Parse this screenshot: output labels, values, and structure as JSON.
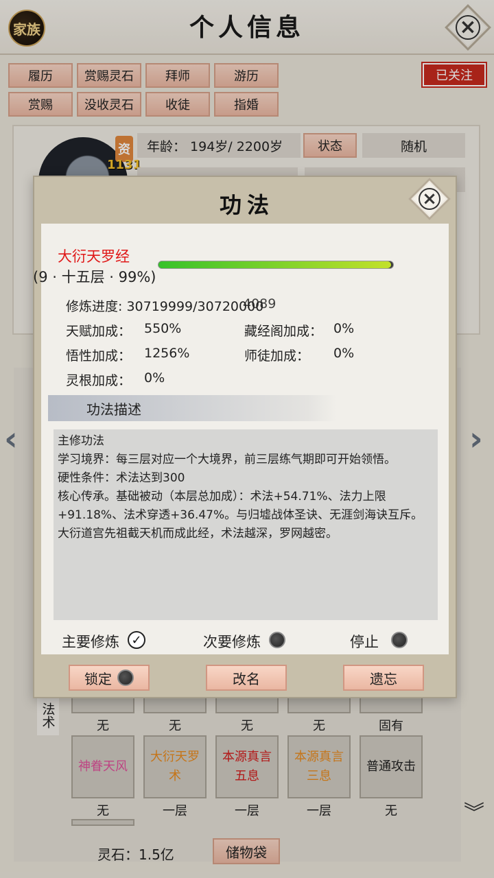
{
  "header": {
    "family_label": "家族",
    "title": "个人信息"
  },
  "actions_row1": [
    "履历",
    "赏赐灵石",
    "拜师",
    "游历"
  ],
  "actions_row2": [
    "赏赐",
    "没收灵石",
    "收徒",
    "指婚"
  ],
  "follow_label": "已关注",
  "profile": {
    "zi_label": "资",
    "zi_value": "1131",
    "age": "年龄：  194岁/ 2200岁",
    "status_label": "状态",
    "random_label": "随机"
  },
  "skill_dialog": {
    "title": "功法",
    "skill_name": "大衍天罗经",
    "level_text": "(9 · 十五层 · 99%)",
    "progress_fraction": 0.99,
    "progress_text": "修炼进度: 30719999/30720000",
    "progress_overlay": "4089",
    "talent_label": "天赋加成：",
    "talent_value": "550%",
    "library_label": "藏经阁加成：",
    "library_value": "0%",
    "comprehension_label": "悟性加成：",
    "comprehension_value": "1256%",
    "master_label": "师徒加成：",
    "master_value": "0%",
    "root_label": "灵根加成：",
    "root_value": "0%",
    "desc_header": "功法描述",
    "desc_lines": [
      "主修功法",
      "学习境界：每三层对应一个大境界，前三层练气期即可开始领悟。",
      "硬性条件：术法达到300",
      "核心传承。基础被动（本层总加成）：术法+54.71%、法力上限+91.18%、法术穿透+36.47%。与归墟战体圣诀、无涯剑海诀互斥。",
      "大衍道宫先祖截天机而成此经，术法越深，罗网越密。"
    ],
    "main_practice": "主要修炼",
    "secondary_practice": "次要修炼",
    "stop": "停止",
    "lock": "锁定",
    "rename": "改名",
    "forget": "遗忘"
  },
  "spells": {
    "side_label": "法术",
    "top_captions": [
      "无",
      "无",
      "无",
      "无",
      "固有"
    ],
    "slots": [
      {
        "name": "神眷天风",
        "color": "#e0509a",
        "caption": "无"
      },
      {
        "name": "大衍天罗术",
        "color": "#e88a1e",
        "caption": "一层"
      },
      {
        "name": "本源真言五息",
        "color": "#d21c1c",
        "caption": "一层"
      },
      {
        "name": "本源真言三息",
        "color": "#e88a1e",
        "caption": "一层"
      },
      {
        "name": "普通攻击",
        "color": "#222222",
        "caption": "无"
      }
    ]
  },
  "footer": {
    "spirit_stone": "灵石：1.5亿",
    "storage_bag": "储物袋"
  }
}
